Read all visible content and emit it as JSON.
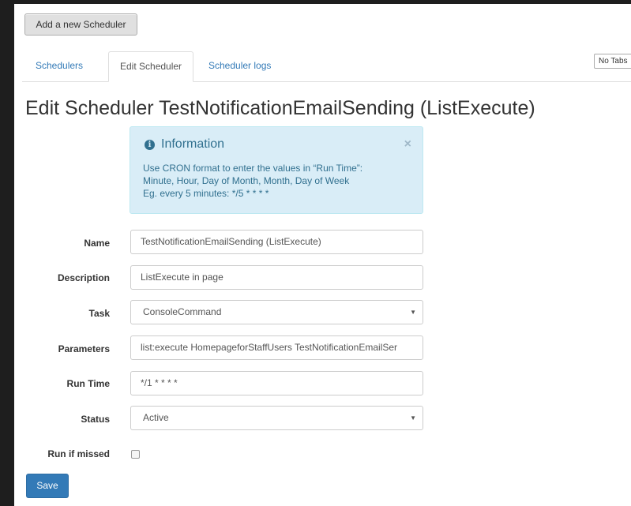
{
  "toolbar": {
    "add_label": "Add a new Scheduler"
  },
  "tabs": [
    {
      "label": "Schedulers",
      "active": false
    },
    {
      "label": "Edit Scheduler",
      "active": true
    },
    {
      "label": "Scheduler logs",
      "active": false
    }
  ],
  "no_tabs_label": "No Tabs",
  "page_title": "Edit Scheduler TestNotificationEmailSending (ListExecute)",
  "info": {
    "icon": "info-circle-icon",
    "title": "Information",
    "close": "×",
    "lines": [
      "Use CRON format to enter the values in “Run Time”:",
      "Minute, Hour, Day of Month, Month, Day of Week",
      "Eg. every 5 minutes: */5 * * * *"
    ]
  },
  "form": {
    "name": {
      "label": "Name",
      "value": "TestNotificationEmailSending (ListExecute)"
    },
    "description": {
      "label": "Description",
      "value": "ListExecute in page"
    },
    "task": {
      "label": "Task",
      "value": "ConsoleCommand"
    },
    "parameters": {
      "label": "Parameters",
      "value": "list:execute HomepageforStaffUsers TestNotificationEmailSer"
    },
    "run_time": {
      "label": "Run Time",
      "value": "*/1 * * * *"
    },
    "status": {
      "label": "Status",
      "value": "Active"
    },
    "run_if_missed": {
      "label": "Run if missed",
      "checked": false
    },
    "caret": "▼"
  },
  "save_label": "Save",
  "colors": {
    "primary": "#337ab7",
    "info_bg": "#d9edf7",
    "info_text": "#31708f"
  }
}
